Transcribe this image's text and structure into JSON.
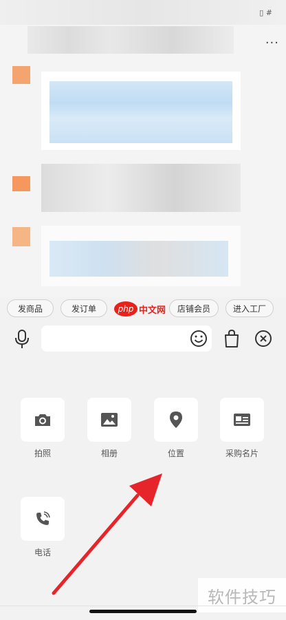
{
  "quick_actions": {
    "items": [
      "发商品",
      "发订单",
      "店铺会员",
      "进入工厂"
    ]
  },
  "input": {
    "placeholder": ""
  },
  "panel": {
    "items": [
      {
        "label": "拍照",
        "icon": "camera-icon"
      },
      {
        "label": "相册",
        "icon": "image-icon"
      },
      {
        "label": "位置",
        "icon": "location-pin-icon"
      },
      {
        "label": "采购名片",
        "icon": "business-card-icon"
      },
      {
        "label": "电话",
        "icon": "phone-icon"
      }
    ]
  },
  "watermark": {
    "text": "软件技巧",
    "logo_php": "php",
    "logo_cn": "中文网"
  },
  "colors": {
    "accent_red": "#e8211a",
    "annotation_arrow": "#e5252a",
    "tile_bg": "#ffffff",
    "panel_bg": "#f2f2f2"
  }
}
